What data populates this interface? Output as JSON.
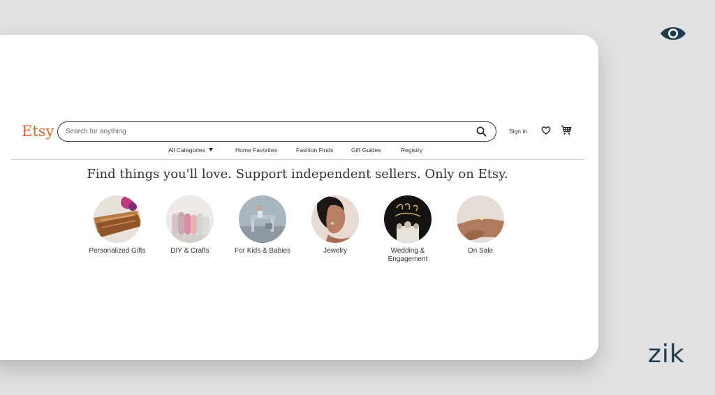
{
  "header": {
    "logo": "Etsy",
    "search": {
      "placeholder": "Search for anything",
      "value": ""
    },
    "sign_in": "Sign in"
  },
  "nav": {
    "items": [
      "All Categories",
      "Home Favorites",
      "Fashion Finds",
      "Gift Guides",
      "Registry"
    ]
  },
  "tagline": "Find things you'll love. Support independent sellers. Only on Etsy.",
  "categories": [
    {
      "label": "Personalized Gifts",
      "image": "cutting-board-photo"
    },
    {
      "label": "DIY & Crafts",
      "image": "fabric-rolls-photo"
    },
    {
      "label": "For Kids & Babies",
      "image": "kids-room-photo"
    },
    {
      "label": "Jewelry",
      "image": "earring-portrait-photo"
    },
    {
      "label": "Wedding & Engagement",
      "image": "cake-topper-photo"
    },
    {
      "label": "On Sale",
      "image": "bracelet-wrist-photo"
    }
  ],
  "branding": {
    "corner_logo": "zik",
    "corner_icon": "eye-icon"
  },
  "colors": {
    "etsy_orange": "#e0662b",
    "zik_navy": "#1f3b4d",
    "page_bg": "#e1e1e1"
  }
}
